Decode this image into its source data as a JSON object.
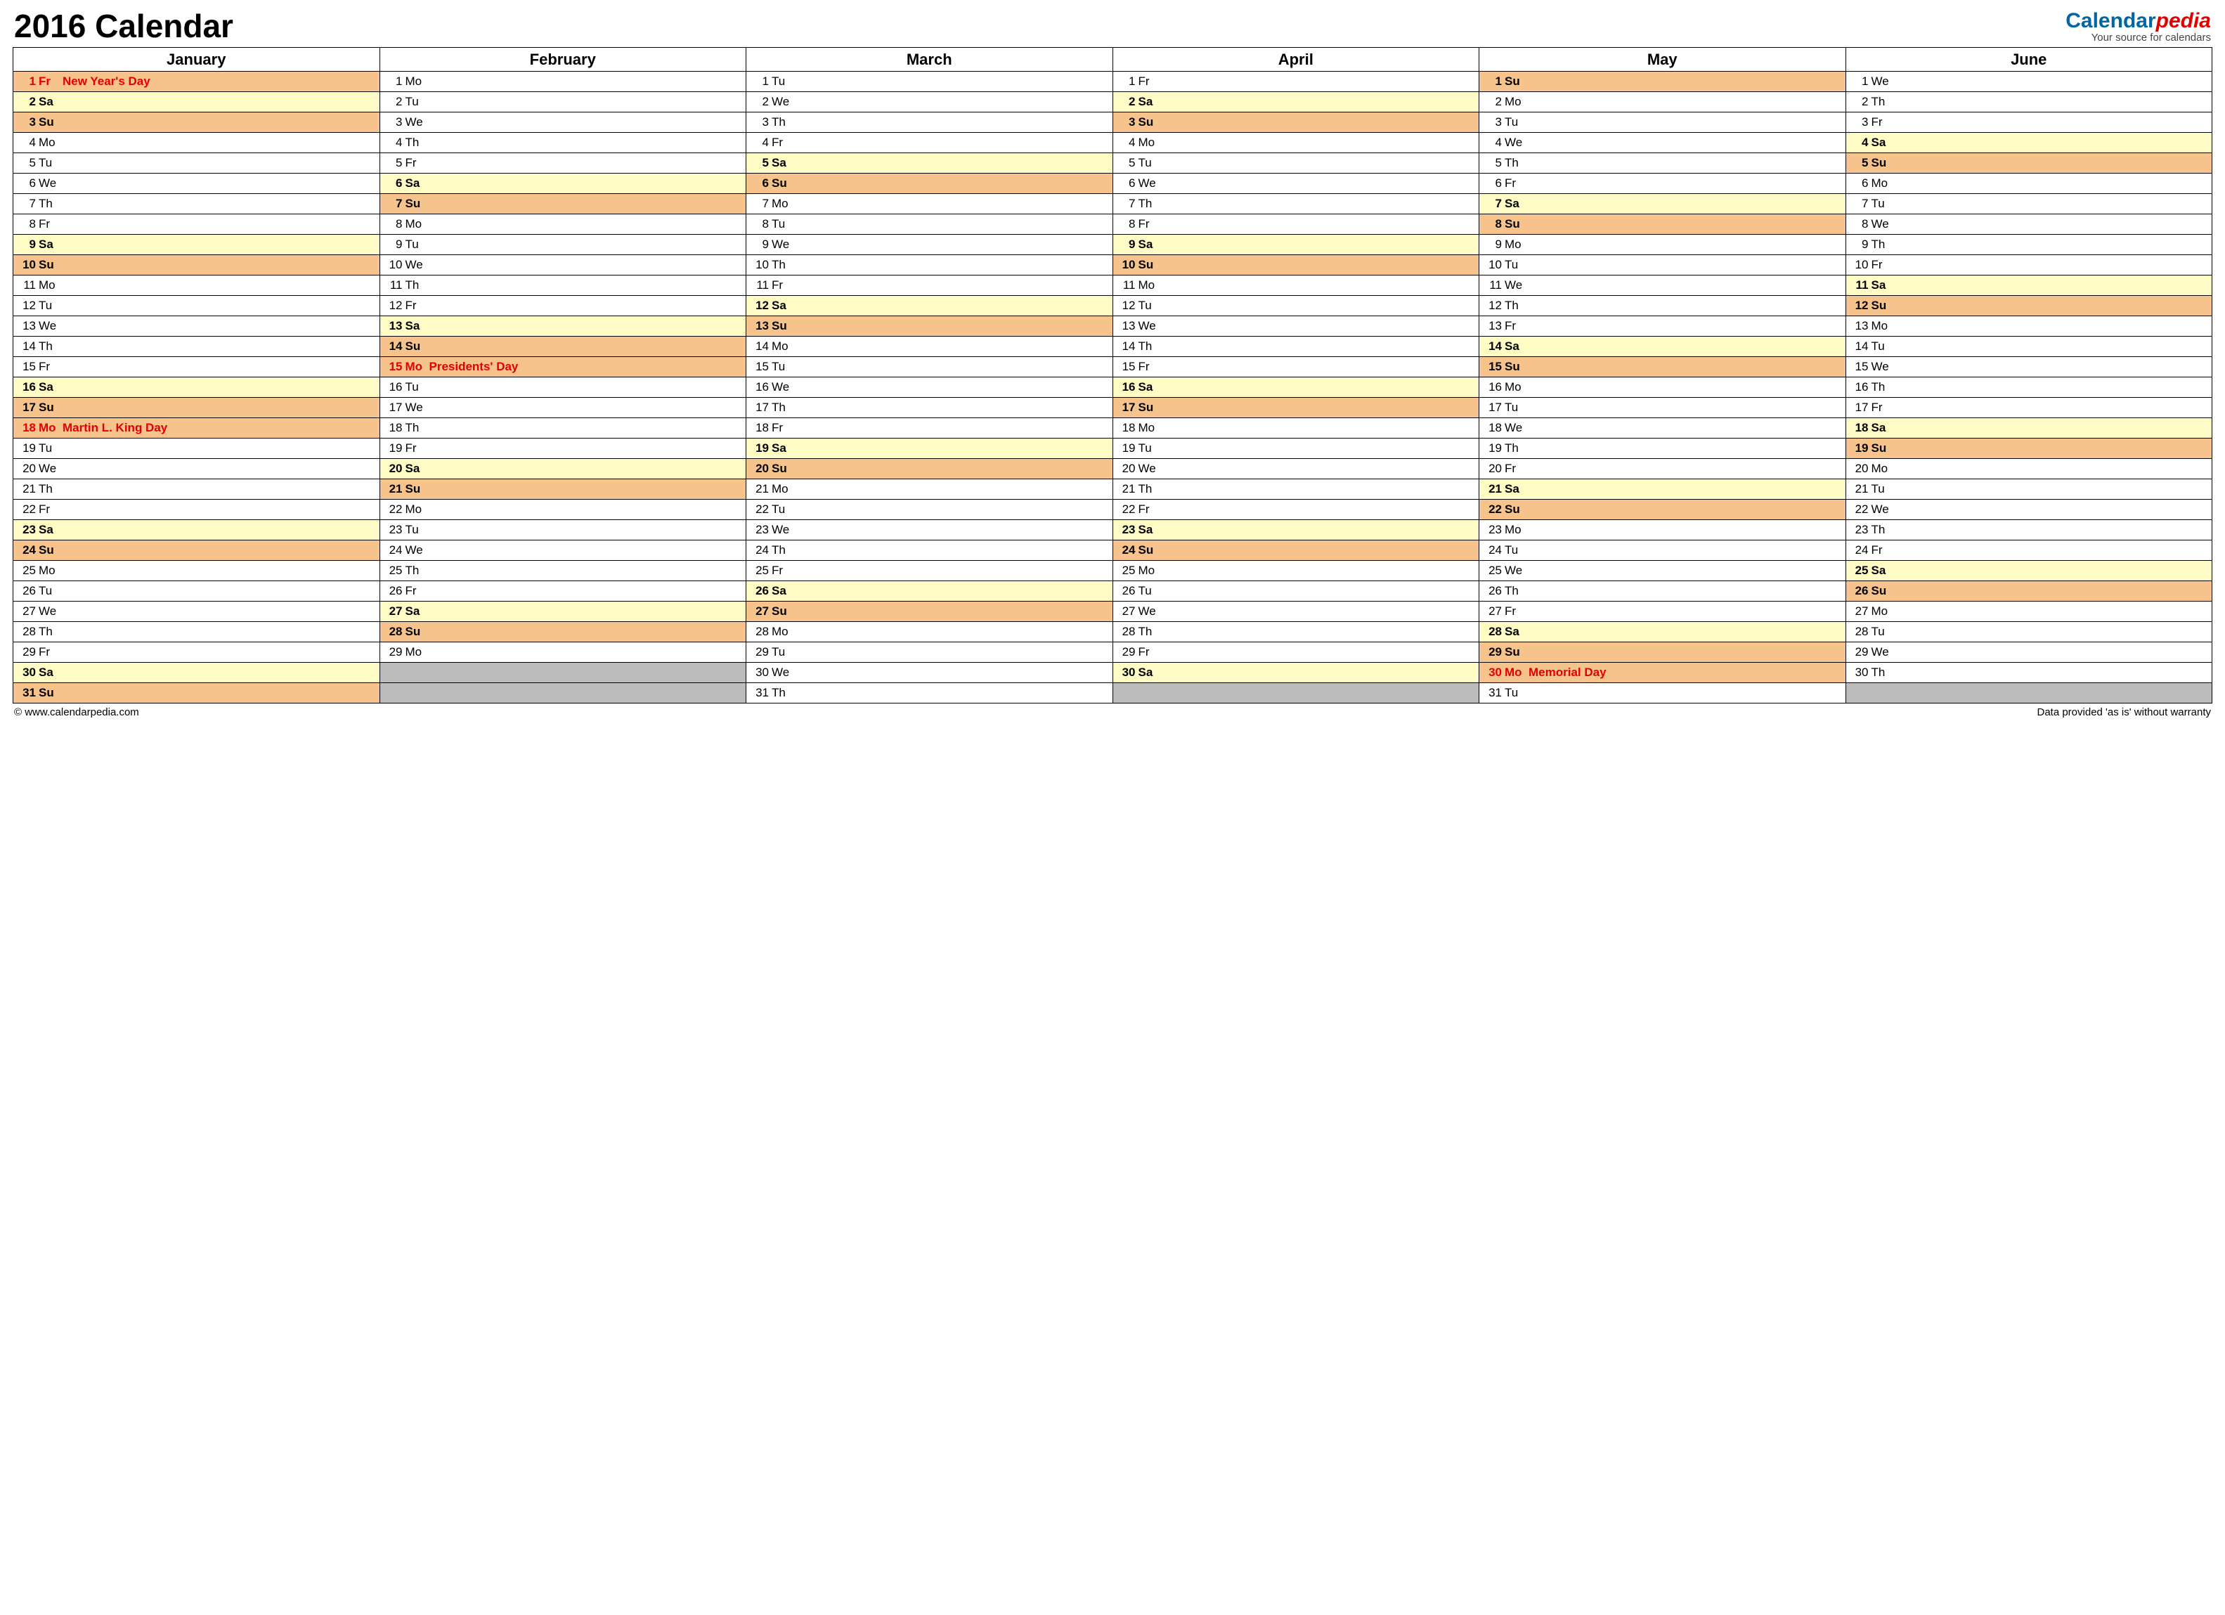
{
  "title": "2016 Calendar",
  "brand": {
    "calendar": "Calendar",
    "pedia": "pedia",
    "sub": "Your source for calendars"
  },
  "footer": {
    "left": "© www.calendarpedia.com",
    "right": "Data provided 'as is' without warranty"
  },
  "months": [
    "January",
    "February",
    "March",
    "April",
    "May",
    "June"
  ],
  "dow": [
    "Su",
    "Mo",
    "Tu",
    "We",
    "Th",
    "Fr",
    "Sa"
  ],
  "startDow": [
    5,
    1,
    2,
    5,
    0,
    3
  ],
  "daysInMonth": [
    31,
    29,
    31,
    30,
    31,
    30
  ],
  "rows": 31,
  "holidays": {
    "0": {
      "1": "New Year's Day",
      "18": "Martin L. King Day"
    },
    "1": {
      "15": "Presidents' Day"
    },
    "4": {
      "30": "Memorial Day"
    }
  }
}
